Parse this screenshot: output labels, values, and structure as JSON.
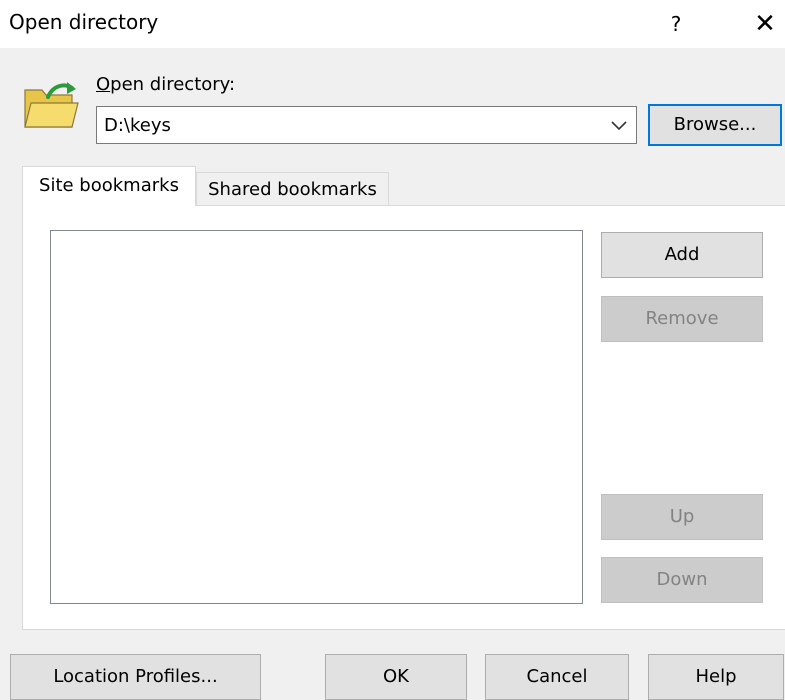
{
  "window": {
    "title": "Open directory",
    "help_label": "?",
    "close_label": "✕"
  },
  "directory": {
    "label_accel": "O",
    "label_rest": "pen directory:",
    "value": "D:\\keys",
    "browse_label": "Browse..."
  },
  "tabs": [
    {
      "label": "Site bookmarks",
      "active": true
    },
    {
      "label": "Shared bookmarks",
      "active": false
    }
  ],
  "bookmarks": {
    "items": [],
    "add_label": "Add",
    "remove_label": "Remove",
    "up_label": "Up",
    "down_label": "Down"
  },
  "footer": {
    "location_profiles_label": "Location Profiles...",
    "ok_label": "OK",
    "cancel_label": "Cancel",
    "help_label": "Help"
  },
  "colors": {
    "focus_border": "#0078d7",
    "folder_yellow": "#f5dc6c",
    "arrow_green": "#2e9a3e"
  }
}
